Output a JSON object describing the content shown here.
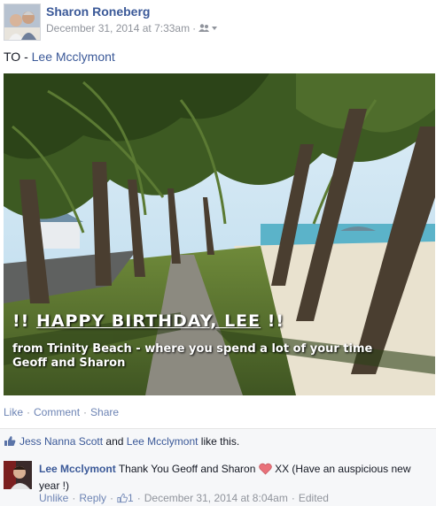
{
  "post": {
    "author": "Sharon Roneberg",
    "timestamp": "December 31, 2014 at 7:33am",
    "audience_icon": "friends-icon",
    "to_prefix": "TO - ",
    "to_name": "Lee Mcclymont"
  },
  "photo": {
    "caption_prefix": "!! ",
    "caption_headline": "HAPPY  BIRTHDAY, LEE",
    "caption_suffix": " !!",
    "caption_line2": "from Trinity Beach - where you spend a lot of your time",
    "caption_line3": "Geoff and Sharon"
  },
  "actions": {
    "like": "Like",
    "comment": "Comment",
    "share": "Share",
    "separator": "·"
  },
  "likes": {
    "user1": "Jess Nanna Scott",
    "and": " and ",
    "user2": "Lee Mcclymont",
    "suffix": " like this."
  },
  "comment": {
    "author": "Lee Mcclymont",
    "text_before": " Thank You Geoff and Sharon ",
    "text_after": " XX (Have an auspicious new year !)",
    "unlike": "Unlike",
    "reply": "Reply",
    "like_count": "1",
    "timestamp": "December 31, 2014 at 8:04am",
    "edited": "Edited"
  },
  "colors": {
    "link": "#3b5998",
    "meta": "#90949c",
    "heart": "#e9717a"
  }
}
